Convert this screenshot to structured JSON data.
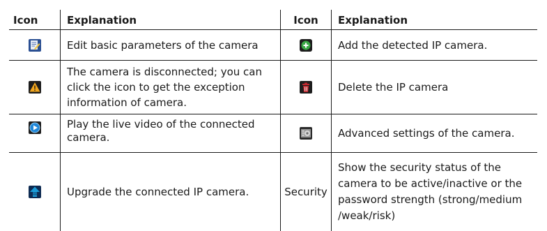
{
  "headers": [
    "Icon",
    "Explanation",
    "Icon",
    "Explanation"
  ],
  "rows": [
    {
      "left_icon": "edit-icon",
      "left_text": "Edit basic parameters of the camera",
      "right_icon": "add-icon",
      "right_text": "Add the detected IP camera."
    },
    {
      "left_icon": "warning-icon",
      "left_text": "The camera is disconnected; you can click the icon to get the exception information of camera.",
      "right_icon": "delete-icon",
      "right_text": "Delete the IP camera"
    },
    {
      "left_icon": "play-icon",
      "left_text": "Play the live video of the connected camera.",
      "right_icon": "settings-icon",
      "right_text": "Advanced settings of the camera."
    },
    {
      "left_icon": "upgrade-icon",
      "left_text": "Upgrade the connected IP camera.",
      "right_label": "Security",
      "right_text": "Show the security status of the camera to be active/inactive or the password strength (strong/medium /weak/risk)"
    }
  ],
  "colors": {
    "line": "#1a1a1a",
    "add_green": "#3aa845",
    "warning_orange": "#f0a51e",
    "delete_red": "#c0262d",
    "play_blue": "#1f87d8",
    "upgrade_teal": "#1a9bd6"
  }
}
